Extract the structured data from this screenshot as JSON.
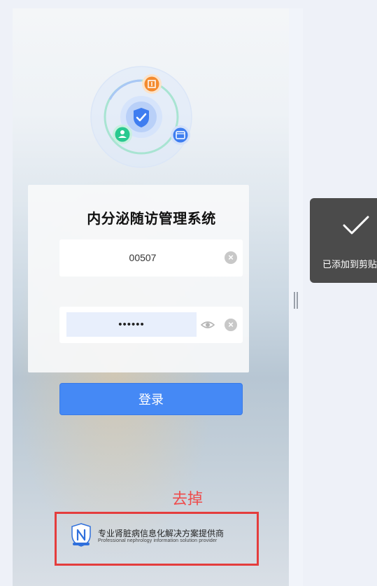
{
  "login": {
    "title": "内分泌随访管理系统",
    "username_value": "00507",
    "password_masked": "••••••",
    "submit_label": "登录"
  },
  "annotation": {
    "text": "去掉"
  },
  "footer": {
    "brand_title": "专业肾脏病信息化解决方案提供商",
    "brand_subtitle": "Professional nephrology information solution provider"
  },
  "toast": {
    "text": "已添加到剪贴"
  },
  "colors": {
    "primary": "#4589f5",
    "annotation_red": "#e43d3d",
    "toast_bg": "#4b4b4b"
  },
  "icons": [
    "shield-check-icon",
    "hospital-icon",
    "doctor-icon",
    "app-icon",
    "clear-icon",
    "eye-icon",
    "checkmark-icon",
    "brand-logo-icon"
  ]
}
